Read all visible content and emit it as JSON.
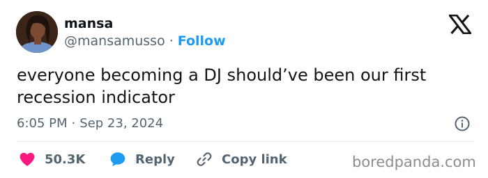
{
  "author": {
    "name": "mansa",
    "handle": "@mansamusso",
    "separator": "·",
    "follow_label": "Follow"
  },
  "tweet": {
    "text": "everyone becoming a DJ should’ve been our first recession indicator",
    "time": "6:05 PM",
    "separator": "·",
    "date": "Sep 23, 2024"
  },
  "actions": {
    "likes": "50.3K",
    "reply_label": "Reply",
    "copy_label": "Copy link"
  },
  "icons": {
    "like": "heart-icon",
    "reply": "speech-bubble-icon",
    "copy": "link-icon",
    "info": "info-icon",
    "brand": "x-logo-icon"
  },
  "colors": {
    "accent": "#1d9bf0",
    "like": "#f91880",
    "muted": "#536471"
  },
  "watermark": "boredpanda.com"
}
